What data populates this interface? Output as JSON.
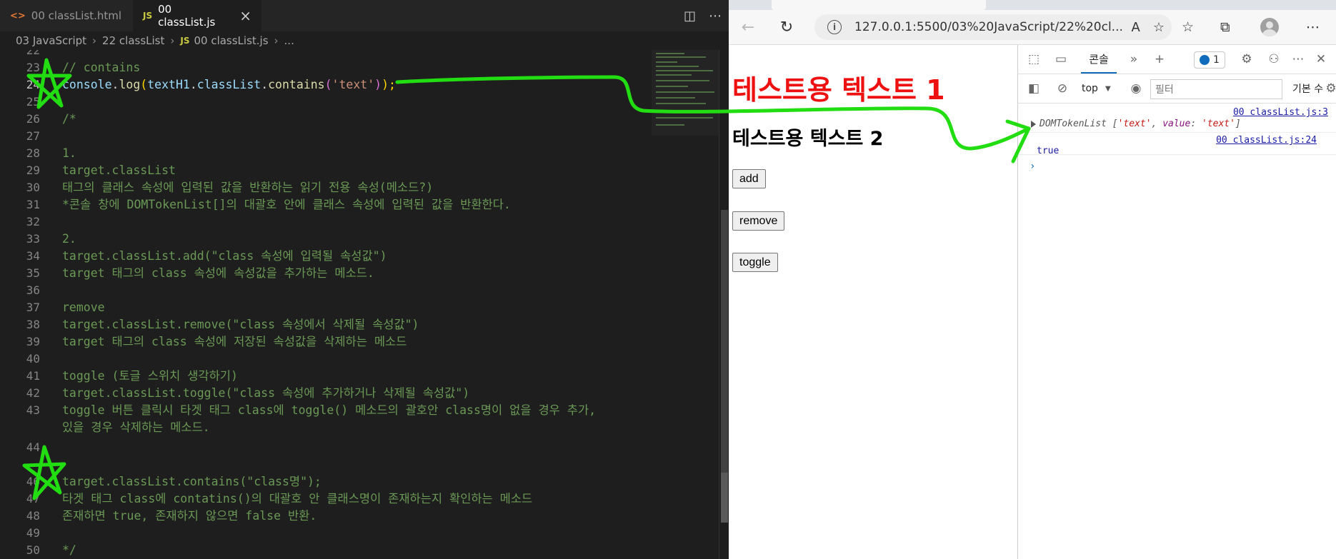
{
  "editor": {
    "tabs": [
      {
        "icon": "<>",
        "label": "00 classList.html",
        "active": false
      },
      {
        "icon": "JS",
        "label": "00 classList.js",
        "active": true
      }
    ],
    "breadcrumb": [
      "03 JavaScript",
      "22 classList",
      "00 classList.js",
      "..."
    ],
    "lines": [
      {
        "n": "22",
        "text": ""
      },
      {
        "n": "23",
        "text": "// contains"
      },
      {
        "n": "24",
        "text": "console.log(textH1.classList.contains('text'));"
      },
      {
        "n": "25",
        "text": ""
      },
      {
        "n": "26",
        "text": "/*"
      },
      {
        "n": "27",
        "text": ""
      },
      {
        "n": "28",
        "text": "1."
      },
      {
        "n": "29",
        "text": "target.classList"
      },
      {
        "n": "30",
        "text": "태그의 클래스 속성에 입력된 값을 반환하는 읽기 전용 속성(메소드?)"
      },
      {
        "n": "31",
        "text": "*콘솔 창에 DOMTokenList[]의 대괄호 안에 클래스 속성에 입력된 값을 반환한다."
      },
      {
        "n": "32",
        "text": ""
      },
      {
        "n": "33",
        "text": "2."
      },
      {
        "n": "34",
        "text": "target.classList.add(\"class 속성에 입력될 속성값\")"
      },
      {
        "n": "35",
        "text": "target 태그의 class 속성에 속성값을 추가하는 메소드."
      },
      {
        "n": "36",
        "text": ""
      },
      {
        "n": "37",
        "text": "remove"
      },
      {
        "n": "38",
        "text": "target.classList.remove(\"class 속성에서 삭제될 속성값\")"
      },
      {
        "n": "39",
        "text": "target 태그의 class 속성에 저장된 속성값을 삭제하는 메소드"
      },
      {
        "n": "40",
        "text": ""
      },
      {
        "n": "41",
        "text": "toggle (토글 스위치 생각하기)"
      },
      {
        "n": "42",
        "text": "target.classList.toggle(\"class 속성에 추가하거나 삭제될 속성값\")"
      },
      {
        "n": "43",
        "text": "toggle 버튼 클릭시 타겟 태그 class에 toggle() 메소드의 괄호안 class명이 없을 경우 추가,"
      },
      {
        "n": "",
        "text": "있을 경우 삭제하는 메소드."
      },
      {
        "n": "44",
        "text": ""
      },
      {
        "n": "",
        "text": ""
      },
      {
        "n": "46",
        "text": "target.classList.contains(\"class명\");"
      },
      {
        "n": "47",
        "text": "타겟 태그 class에 contatins()의 대괄호 안 클래스명이 존재하는지 확인하는 메소드"
      },
      {
        "n": "48",
        "text": "존재하면 true, 존재하지 않으면 false 반환."
      },
      {
        "n": "49",
        "text": ""
      },
      {
        "n": "50",
        "text": "*/"
      },
      {
        "n": "51",
        "text": ""
      }
    ],
    "code24": {
      "a": "console",
      "b": ".",
      "c": "log",
      "d": "(",
      "e": "textH1",
      "f": ".",
      "g": "classList",
      "h": ".",
      "i": "contains",
      "j": "(",
      "k": "'text'",
      "l": ")",
      "m": ");"
    }
  },
  "browser": {
    "url": "127.0.0.1:5500/03%20JavaScript/22%20cl...",
    "page": {
      "heading1": "테스트용 텍스트 1",
      "heading2": "테스트용 텍스트 2",
      "buttons": [
        "add",
        "remove",
        "toggle"
      ]
    }
  },
  "devtools": {
    "console_tab": "콘솔",
    "issues_count": "1",
    "context": "top",
    "filter_placeholder": "필터",
    "levels": "기본 수",
    "messages": [
      {
        "source": "00 classList.js:3",
        "text": "DOMTokenList ['text', value: 'text']"
      },
      {
        "source": "00 classList.js:24",
        "text": "true"
      }
    ],
    "token_parts": {
      "a": "DOMTokenList [",
      "b": "'text'",
      "c": ", ",
      "d": "value",
      "e": ": ",
      "f": "'text'",
      "g": "]"
    }
  },
  "colors": {
    "accent": "#0f6cbd",
    "heading1": "#ee1111",
    "annotation": "#22dd11"
  }
}
